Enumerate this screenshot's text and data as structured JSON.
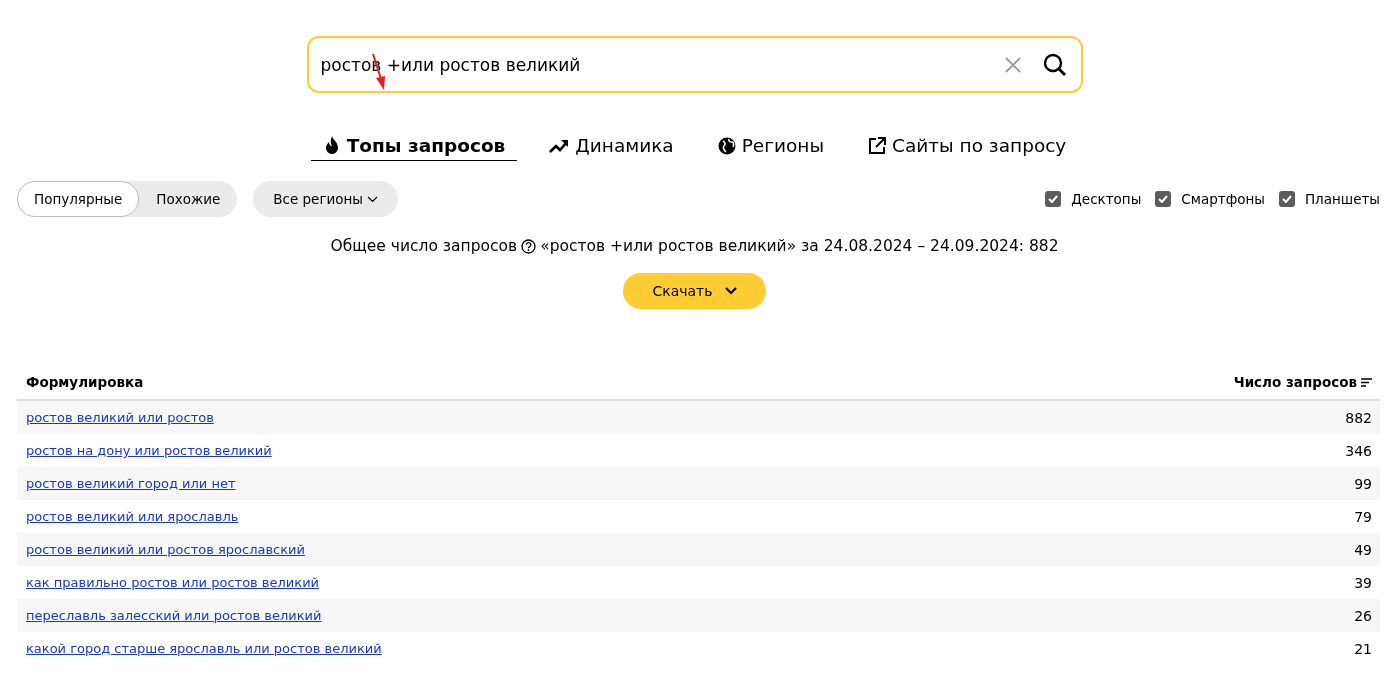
{
  "search": {
    "value": "ростов +или ростов великий"
  },
  "tabs": [
    {
      "label": "Топы запросов",
      "selected": true
    },
    {
      "label": "Динамика",
      "selected": false
    },
    {
      "label": "Регионы",
      "selected": false
    },
    {
      "label": "Сайты по запросу",
      "selected": false
    }
  ],
  "mode_switch": [
    {
      "label": "Популярные",
      "selected": true
    },
    {
      "label": "Похожие",
      "selected": false
    }
  ],
  "region_select": {
    "label": "Все регионы"
  },
  "devices": [
    {
      "label": "Десктопы",
      "checked": true
    },
    {
      "label": "Смартфоны",
      "checked": true
    },
    {
      "label": "Планшеты",
      "checked": true
    }
  ],
  "summary": {
    "label": "Общее число запросов",
    "text": "«ростов +или ростов великий» за 24.08.2024 – 24.09.2024: 882"
  },
  "download_button": {
    "label": "Скачать"
  },
  "table": {
    "columns": [
      "Формулировка",
      "Число запросов"
    ],
    "rows": [
      {
        "phrase": "ростов великий или ростов",
        "count": "882"
      },
      {
        "phrase": "ростов на дону или ростов великий",
        "count": "346"
      },
      {
        "phrase": "ростов великий город или нет",
        "count": "99"
      },
      {
        "phrase": "ростов великий или ярославль",
        "count": "79"
      },
      {
        "phrase": "ростов великий или ростов ярославский",
        "count": "49"
      },
      {
        "phrase": "как правильно ростов или ростов великий",
        "count": "39"
      },
      {
        "phrase": "переславль залесский или ростов великий",
        "count": "26"
      },
      {
        "phrase": "какой город старше ярославль или ростов великий",
        "count": "21"
      }
    ]
  }
}
